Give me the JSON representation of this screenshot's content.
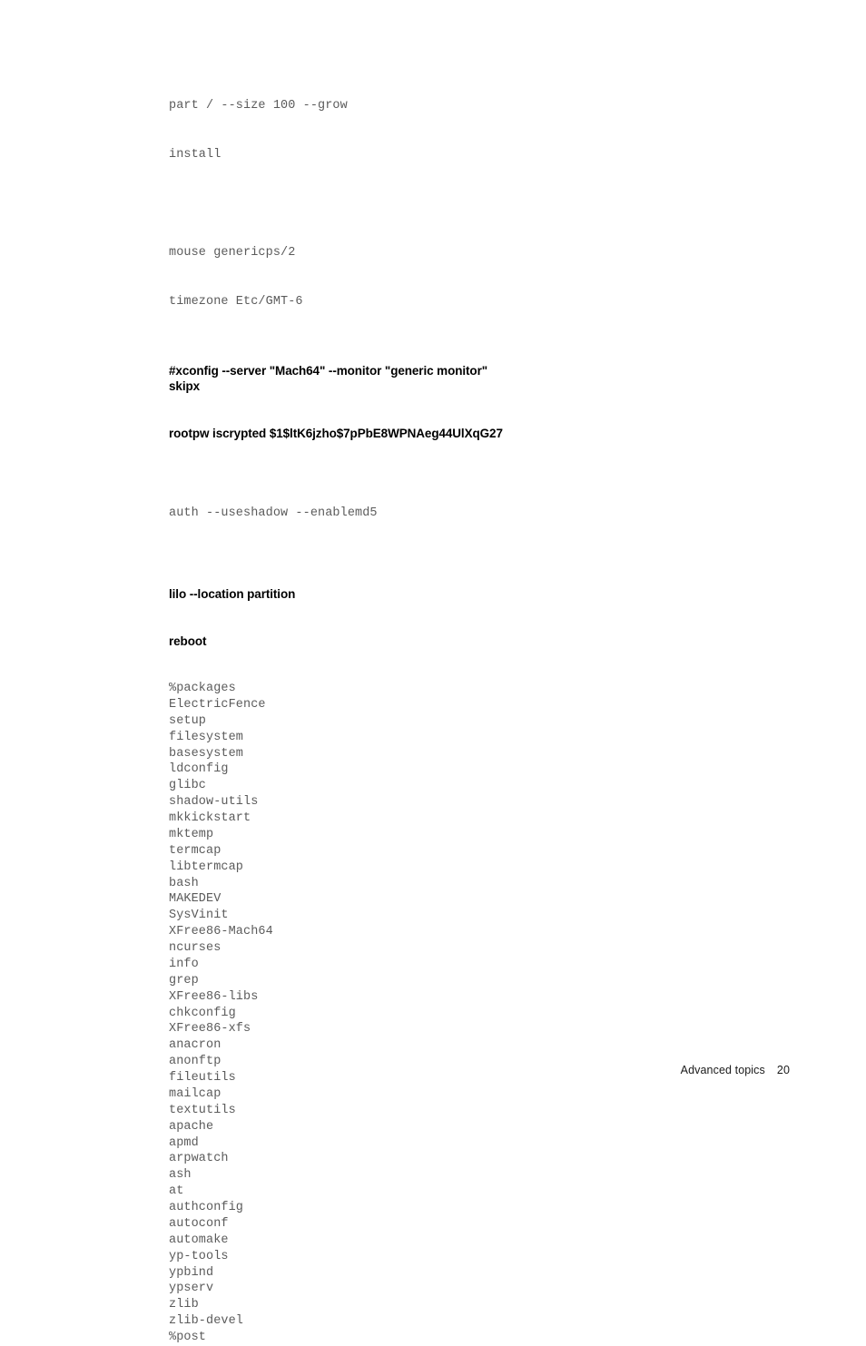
{
  "document": {
    "body_blocks": [
      {
        "type": "code",
        "lines": [
          "part / --size 100 --grow",
          "install"
        ]
      },
      {
        "type": "code",
        "lines": [
          "mouse genericps/2",
          "timezone Etc/GMT-6"
        ]
      },
      {
        "type": "bold",
        "lines": [
          "#xconfig --server \"Mach64\" --monitor \"generic monitor\"",
          "skipx"
        ]
      },
      {
        "type": "bold",
        "lines": [
          "rootpw iscrypted $1$ltK6jzho$7pPbE8WPNAeg44UlXqG27"
        ]
      },
      {
        "type": "code",
        "lines": [
          "auth --useshadow --enablemd5"
        ]
      },
      {
        "type": "bold",
        "lines": [
          "lilo --location partition"
        ]
      },
      {
        "type": "bold",
        "lines": [
          "reboot"
        ]
      }
    ],
    "package_list": [
      "%packages",
      "ElectricFence",
      "setup",
      "filesystem",
      "basesystem",
      "ldconfig",
      "glibc",
      "shadow-utils",
      "mkkickstart",
      "mktemp",
      "termcap",
      "libtermcap",
      "bash",
      "MAKEDEV",
      "SysVinit",
      "XFree86-Mach64",
      "ncurses",
      "info",
      "grep",
      "XFree86-libs",
      "chkconfig",
      "XFree86-xfs",
      "anacron",
      "anonftp",
      "fileutils",
      "mailcap",
      "textutils",
      "apache",
      "apmd",
      "arpwatch",
      "ash",
      "at",
      "authconfig",
      "autoconf",
      "automake",
      "yp-tools",
      "ypbind",
      "ypserv",
      "zlib",
      "zlib-devel",
      "%post"
    ]
  },
  "footer": {
    "chapter_label": "Advanced topics",
    "page_number": "20"
  },
  "colors": {
    "page_background": "#ffffff",
    "code_text": "#5b5b5b",
    "bold_text": "#000000",
    "footer_text": "#1a1a1a"
  }
}
